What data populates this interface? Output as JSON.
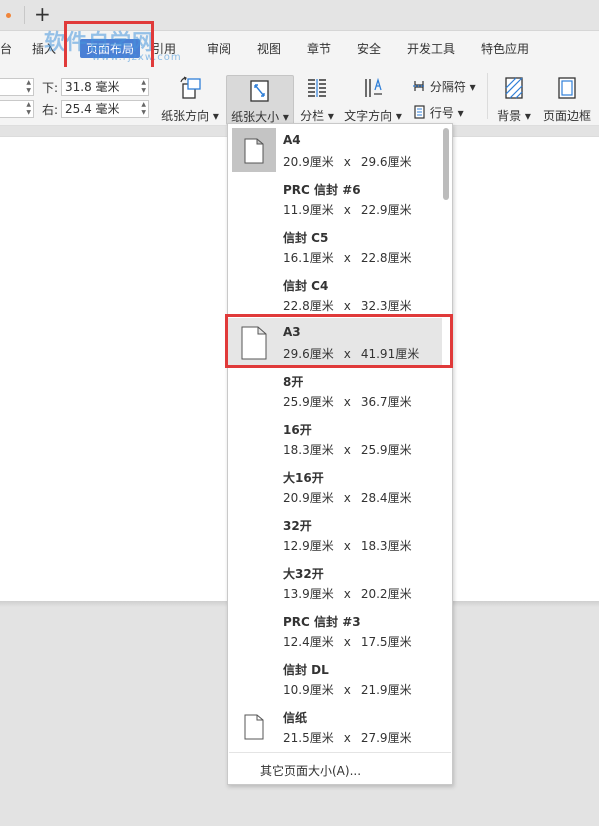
{
  "watermark": {
    "text": "软件自学网",
    "sub": "www.rjzxw.com"
  },
  "menu_tabs": [
    "台",
    "插入",
    "页面布局",
    "引用",
    "审阅",
    "视图",
    "章节",
    "安全",
    "开发工具",
    "特色应用"
  ],
  "margins": {
    "bottom_label": "下:",
    "bottom_value": "31.8 毫米",
    "right_label": "右:",
    "right_value": "25.4 毫米"
  },
  "toolbar": {
    "orientation": "纸张方向",
    "paper_size": "纸张大小",
    "columns": "分栏",
    "text_direction": "文字方向",
    "separator": "分隔符",
    "line_number": "行号",
    "background": "背景",
    "page_border": "页面边框"
  },
  "paper_sizes": [
    {
      "name": "A4",
      "width": "20.9厘米",
      "height": "29.6厘米"
    },
    {
      "name": "PRC 信封 #6",
      "width": "11.9厘米",
      "height": "22.9厘米"
    },
    {
      "name": "信封 C5",
      "width": "16.1厘米",
      "height": "22.8厘米"
    },
    {
      "name": "信封 C4",
      "width": "22.8厘米",
      "height": "32.3厘米"
    },
    {
      "name": "A3",
      "width": "29.6厘米",
      "height": "41.91厘米"
    },
    {
      "name": "8开",
      "width": "25.9厘米",
      "height": "36.7厘米"
    },
    {
      "name": "16开",
      "width": "18.3厘米",
      "height": "25.9厘米"
    },
    {
      "name": "大16开",
      "width": "20.9厘米",
      "height": "28.4厘米"
    },
    {
      "name": "32开",
      "width": "12.9厘米",
      "height": "18.3厘米"
    },
    {
      "name": "大32开",
      "width": "13.9厘米",
      "height": "20.2厘米"
    },
    {
      "name": "PRC 信封 #3",
      "width": "12.4厘米",
      "height": "17.5厘米"
    },
    {
      "name": "信封 DL",
      "width": "10.9厘米",
      "height": "21.9厘米"
    },
    {
      "name": "信纸",
      "width": "21.5厘米",
      "height": "27.9厘米"
    }
  ],
  "dims_separator": "x",
  "more_sizes": "其它页面大小(A)...",
  "colors": {
    "active_tab": "#4a7fd5",
    "highlight": "#e03a3a",
    "selected_row": "#e6e6e6"
  }
}
